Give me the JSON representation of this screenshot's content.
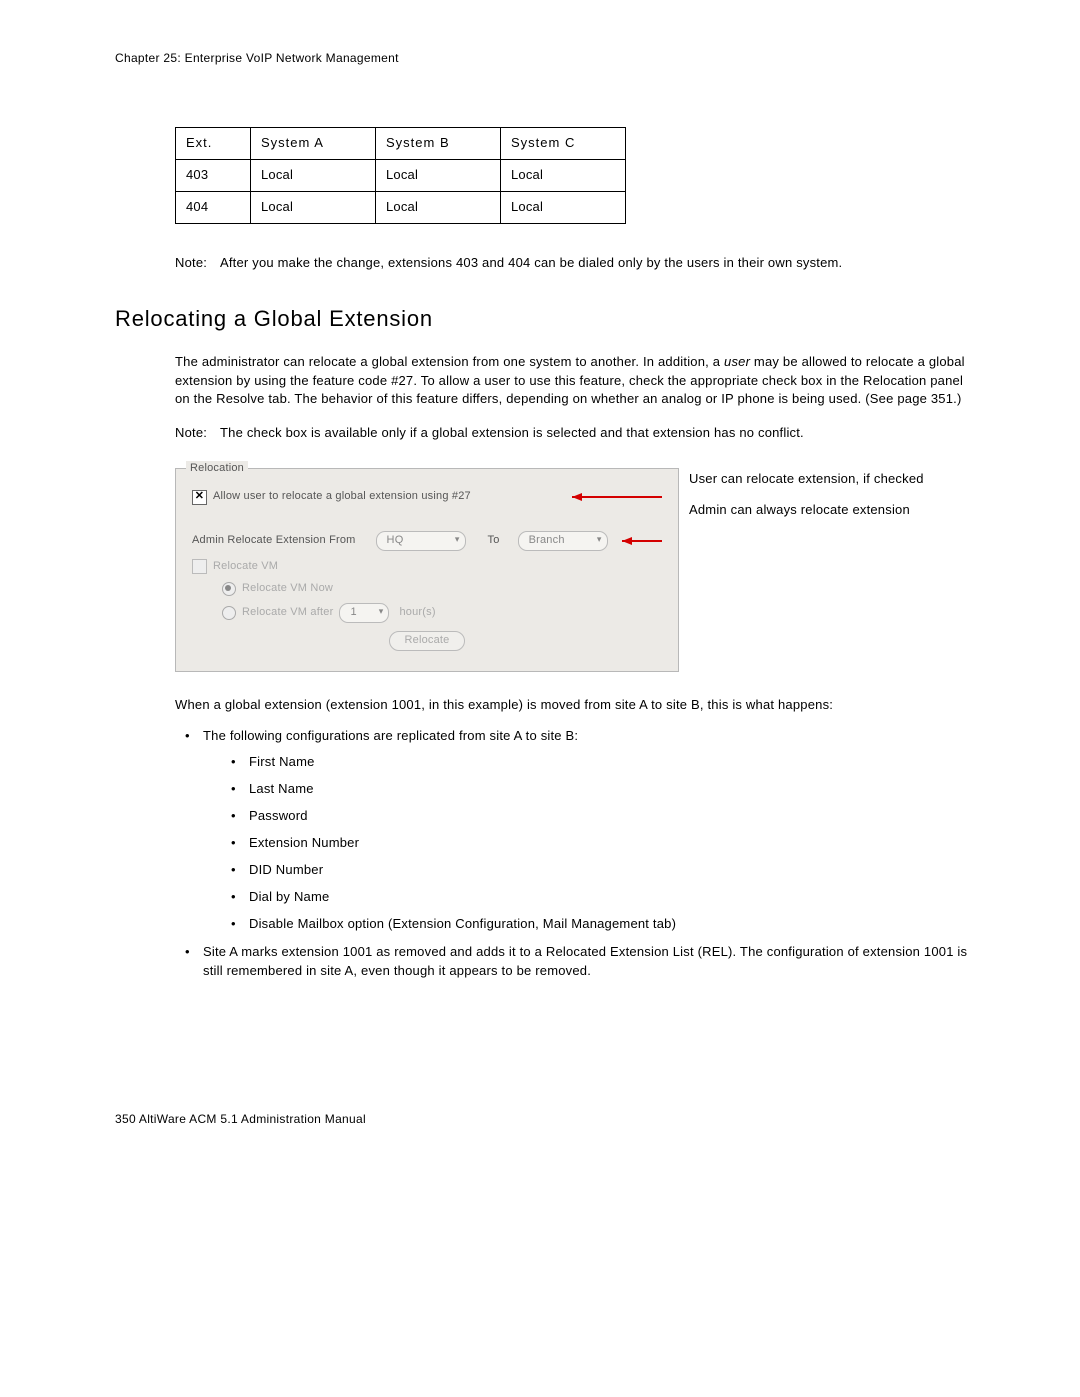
{
  "chapter_header": "Chapter 25:  Enterprise VoIP Network Management",
  "table": {
    "headers": [
      "Ext.",
      "System A",
      "System B",
      "System C"
    ],
    "rows": [
      [
        "403",
        "Local",
        "Local",
        "Local"
      ],
      [
        "404",
        "Local",
        "Local",
        "Local"
      ]
    ]
  },
  "note1": {
    "label": "Note:",
    "text": "After you make the change, extensions 403 and 404 can be dialed only by the users in their own system."
  },
  "section_heading": "Relocating a Global Extension",
  "para1_a": "The administrator can relocate a global extension from one system to another. In addition, a ",
  "para1_user": "user",
  "para1_b": " may be allowed to relocate a global extension by using the feature code #27. To allow a user to use this feature, check the appropriate check box in the Relocation panel on the Resolve tab. The behavior of this feature differs, depending on whether an analog or IP phone is being used. (See page 351.)",
  "note2": {
    "label": "Note:",
    "text": "The check box is available only if a global extension is selected and that extension has no conflict."
  },
  "panel": {
    "group_label": "Relocation",
    "allow_label": "Allow user to relocate a global extension using #27",
    "admin_label": "Admin Relocate Extension From",
    "from_value": "HQ",
    "to_label": "To",
    "to_value": "Branch",
    "relocate_vm_label": "Relocate VM",
    "vm_now_label": "Relocate VM Now",
    "vm_after_label": "Relocate VM after",
    "vm_after_value": "1",
    "vm_after_unit": "hour(s)",
    "button_label": "Relocate"
  },
  "callouts": {
    "c1": "User can relocate extension, if checked",
    "c2": "Admin can always relocate extension"
  },
  "para2": "When a global extension (extension 1001, in this example) is moved from site A to site B, this is what happens:",
  "bullets": {
    "b1": "The following configurations are replicated from site A to site B:",
    "sub": [
      "First Name",
      "Last Name",
      "Password",
      "Extension Number",
      "DID Number",
      "Dial by Name",
      "Disable Mailbox option (Extension Configuration, Mail Management tab)"
    ],
    "b2": "Site A marks extension 1001 as removed and adds it to a Relocated Extension List (REL). The configuration of extension 1001 is still remembered in site A, even though it appears to be removed."
  },
  "footer": "350   AltiWare ACM 5.1 Administration Manual"
}
